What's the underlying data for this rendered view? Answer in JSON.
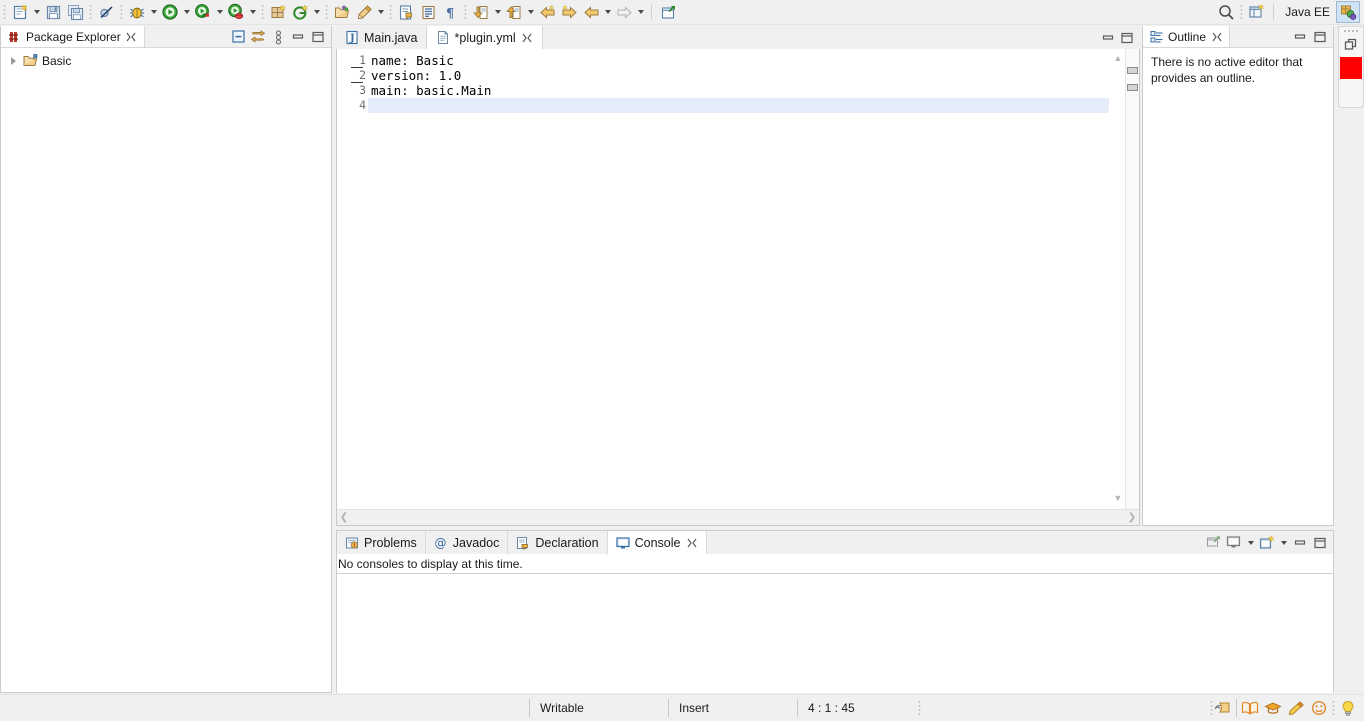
{
  "window": {
    "perspective_label": "Java EE"
  },
  "toolbar": {
    "groups": [
      {
        "buttons": [
          {
            "name": "new-wizard-icon",
            "label": "New",
            "arrow": true
          },
          {
            "name": "save-icon",
            "label": "Save",
            "arrow": false
          },
          {
            "name": "save-all-icon",
            "label": "Save All",
            "arrow": false
          }
        ]
      },
      {
        "buttons": [
          {
            "name": "toggle-breakpoint-icon",
            "label": "Skip All Breakpoints",
            "arrow": false
          }
        ]
      },
      {
        "buttons": [
          {
            "name": "debug-icon",
            "label": "Debug",
            "arrow": true
          },
          {
            "name": "run-icon",
            "label": "Run",
            "arrow": true
          },
          {
            "name": "coverage-icon",
            "label": "Coverage",
            "arrow": true
          },
          {
            "name": "run-external-tools-icon",
            "label": "External Tools",
            "arrow": true
          }
        ]
      },
      {
        "buttons": [
          {
            "name": "new-package-icon",
            "label": "New Java Package",
            "arrow": false
          },
          {
            "name": "new-annotation-icon",
            "label": "New Annotation",
            "arrow": true
          }
        ]
      },
      {
        "buttons": [
          {
            "name": "open-type-icon",
            "label": "Open Type",
            "arrow": false
          },
          {
            "name": "open-task-icon",
            "label": "Open Task",
            "arrow": true
          }
        ]
      },
      {
        "buttons": [
          {
            "name": "search-file-icon",
            "label": "Search",
            "arrow": false
          },
          {
            "name": "show-whitespace-icon",
            "label": "Show Whitespace Characters",
            "arrow": false
          },
          {
            "name": "pilcrow-icon",
            "label": "Toggle Mark Occurrences",
            "arrow": false
          }
        ]
      },
      {
        "buttons": [
          {
            "name": "previous-annotation-icon",
            "label": "Previous Annotation",
            "arrow": true
          },
          {
            "name": "next-annotation-icon",
            "label": "Next Annotation",
            "arrow": true
          },
          {
            "name": "back-to-icon",
            "label": "Back",
            "arrow": false
          },
          {
            "name": "forward-to-icon",
            "label": "Forward",
            "arrow": false
          },
          {
            "name": "previous-edit-icon",
            "label": "Previous Edit Location",
            "arrow": true
          },
          {
            "name": "next-edit-icon",
            "label": "Next Edit Location",
            "arrow": true
          }
        ]
      },
      {
        "buttons": [
          {
            "name": "external-link-icon",
            "label": "Open External",
            "arrow": false
          }
        ]
      }
    ],
    "right": {
      "search_icon": "search-icon",
      "open-perspective_icon": "open-perspective-icon",
      "java_perspective_icon": "java-ee-perspective-icon"
    }
  },
  "package_explorer": {
    "title": "Package Explorer",
    "tools": [
      {
        "name": "collapse-all-button",
        "label": "Collapse All"
      },
      {
        "name": "link-with-editor-button",
        "label": "Link with Editor"
      },
      {
        "name": "view-menu-button",
        "label": "View Menu"
      },
      {
        "name": "minimize-button",
        "label": "Minimize"
      },
      {
        "name": "maximize-button",
        "label": "Maximize"
      }
    ],
    "tree": [
      {
        "label": "Basic",
        "icon": "java-project-icon",
        "expanded": false
      }
    ]
  },
  "editor": {
    "tabs": [
      {
        "label": "Main.java",
        "icon": "java-file-icon",
        "active": false,
        "dirty": false,
        "closable": false
      },
      {
        "label": "*plugin.yml",
        "icon": "text-file-icon",
        "active": true,
        "dirty": true,
        "closable": true
      }
    ],
    "lines": [
      {
        "number": "1",
        "text": "name: Basic",
        "current": false,
        "marked": true
      },
      {
        "number": "2",
        "text": "version: 1.0",
        "current": false,
        "marked": true
      },
      {
        "number": "3",
        "text": "main: basic.Main",
        "current": false,
        "marked": false
      },
      {
        "number": "4",
        "text": "",
        "current": true,
        "marked": false
      }
    ],
    "overview_markers": 2
  },
  "outline": {
    "title": "Outline",
    "message": "There is no active editor that provides an outline.",
    "tools": [
      {
        "name": "minimize-button",
        "label": "Minimize"
      },
      {
        "name": "maximize-button",
        "label": "Maximize"
      }
    ]
  },
  "fastview": {
    "restore_icon": "restore-icon",
    "color_swatch": "#ff0000"
  },
  "bottom_panel": {
    "tabs": [
      {
        "label": "Problems",
        "icon": "problems-icon",
        "active": false,
        "closable": false
      },
      {
        "label": "Javadoc",
        "icon": "javadoc-icon",
        "active": false,
        "closable": false
      },
      {
        "label": "Declaration",
        "icon": "declaration-icon",
        "active": false,
        "closable": false
      },
      {
        "label": "Console",
        "icon": "console-icon",
        "active": true,
        "closable": true
      }
    ],
    "message": "No consoles to display at this time.",
    "tools": [
      {
        "name": "open-console-icon",
        "label": "Open Console"
      },
      {
        "name": "display-selected-console-icon",
        "label": "Display Selected Console",
        "arrow": true
      },
      {
        "name": "new-console-view-icon",
        "label": "New Console View",
        "arrow": true
      },
      {
        "name": "minimize-button",
        "label": "Minimize"
      },
      {
        "name": "maximize-button",
        "label": "Maximize"
      }
    ]
  },
  "statusbar": {
    "writable": "Writable",
    "insert": "Insert",
    "position": "4 : 1 : 45",
    "right_icons": [
      {
        "name": "edit-annotation-icon",
        "label": "Editor Annotation"
      },
      {
        "name": "book-icon",
        "label": "Documentation"
      },
      {
        "name": "graduation-cap-icon",
        "label": "Tutorials"
      },
      {
        "name": "pencil-icon",
        "label": "Edit"
      },
      {
        "name": "smiley-icon",
        "label": "Feedback"
      },
      {
        "name": "lightbulb-icon",
        "label": "Tip of the Day"
      }
    ]
  }
}
